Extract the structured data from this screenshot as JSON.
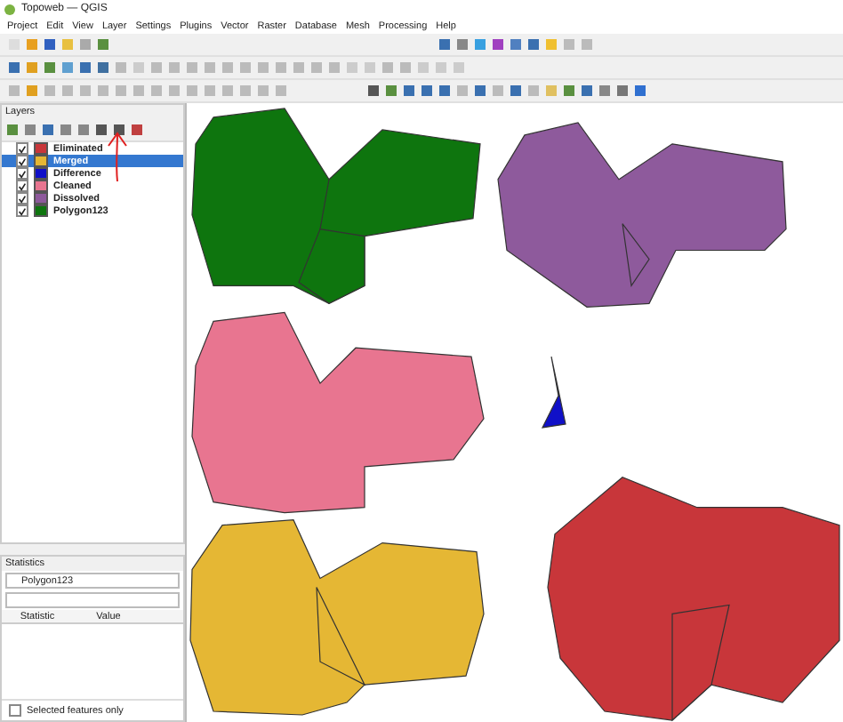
{
  "window": {
    "title": "Topoweb — QGIS"
  },
  "menu": [
    "Project",
    "Edit",
    "View",
    "Layer",
    "Settings",
    "Plugins",
    "Vector",
    "Raster",
    "Database",
    "Mesh",
    "Processing",
    "Help"
  ],
  "layers_panel": {
    "title": "Layers",
    "layers": [
      {
        "name": "Eliminated",
        "color": "#c8363a",
        "checked": true,
        "selected": false
      },
      {
        "name": "Merged",
        "color": "#e5b734",
        "checked": true,
        "selected": true
      },
      {
        "name": "Difference",
        "color": "#1010c8",
        "checked": true,
        "selected": false
      },
      {
        "name": "Cleaned",
        "color": "#e87590",
        "checked": true,
        "selected": false
      },
      {
        "name": "Dissolved",
        "color": "#8e5a9c",
        "checked": true,
        "selected": false
      },
      {
        "name": "Polygon123",
        "color": "#0e750e",
        "checked": true,
        "selected": false
      }
    ]
  },
  "statistics_panel": {
    "title": "Statistics",
    "layer": "Polygon123",
    "columns": [
      "Statistic",
      "Value"
    ],
    "selected_only": {
      "label": "Selected features only",
      "checked": false
    }
  }
}
